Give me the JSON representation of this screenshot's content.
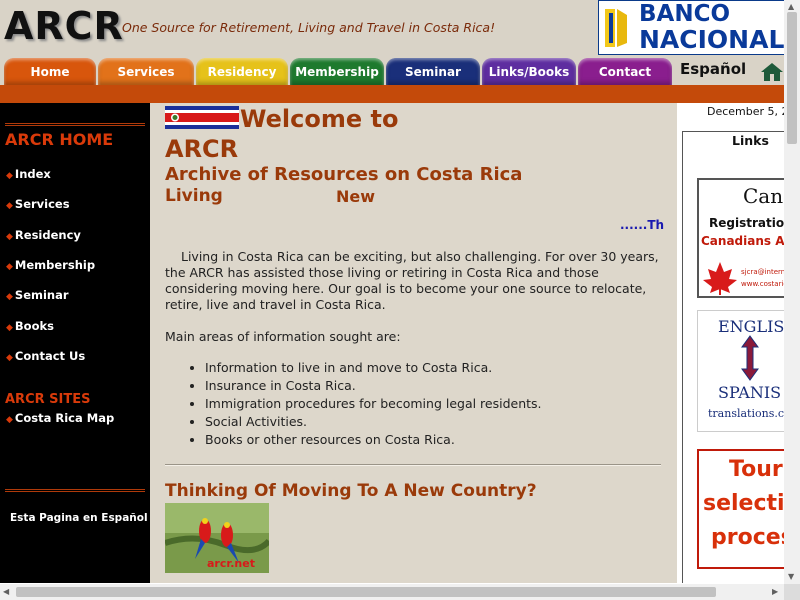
{
  "header": {
    "logo": "ARCR",
    "tagline": "One Source for Retirement, Living and Travel in Costa Rica!",
    "bank_line1": "BANCO",
    "bank_line2": "NACIONAL",
    "language_link": "Español",
    "tabs": [
      {
        "label": "Home",
        "color": "#d8560c"
      },
      {
        "label": "Services",
        "color": "#e2721a"
      },
      {
        "label": "Residency",
        "color": "#e6c21a"
      },
      {
        "label": "Membership",
        "color": "#1e7a2e"
      },
      {
        "label": "Seminar",
        "color": "#1a2f7a"
      },
      {
        "label": "Links/Books",
        "color": "#5e2da0"
      },
      {
        "label": "Contact",
        "color": "#8a1e8e"
      }
    ],
    "accent_bar_color": "#c44a0a"
  },
  "sidebar": {
    "section1_title": "ARCR HOME",
    "items": [
      "Index",
      "Services",
      "Residency",
      "Membership",
      "Seminar",
      "Books",
      "Contact Us"
    ],
    "section2_title": "ARCR SITES",
    "sites": [
      "Costa Rica Map"
    ],
    "spanish_link": "Esta Pagina en Español"
  },
  "main": {
    "welcome": "Welcome to",
    "arcr": "ARCR",
    "subtitle": "Archive of Resources on Costa Rica",
    "living": "Living",
    "new_label": "New",
    "ticker": "......Th",
    "intro": "Living in Costa Rica can be exciting, but also challenging.  For over 30 years, the ARCR has assisted those living or retiring in Costa Rica and those considering moving here. Our goal is to become your one source to relocate, retire, live and travel in Costa Rica.",
    "sought": "Main areas of information sought are:",
    "areas": [
      "Information to live in and move to Costa Rica.",
      "Insurance in Costa Rica.",
      "Immigration procedures for becoming legal residents.",
      "Social Activities.",
      "Books or other resources on Costa Rica."
    ],
    "moving_heading": "Thinking Of Moving To A New Country?",
    "photo_caption": "arcr.net"
  },
  "right": {
    "date": "December 5, 2",
    "links_title": "Links",
    "ad1": {
      "line1": "Cana",
      "line2": "Registration",
      "line3": "Canadians Ab",
      "line4": "sjcra@internat",
      "line5": "www.costarica"
    },
    "ad2": {
      "line1": "ENGLIS",
      "line2": "SPANIS",
      "line3": "translations.c"
    },
    "ad3": {
      "line1": "Tour",
      "line2": "selecti",
      "line3": "proces"
    }
  }
}
